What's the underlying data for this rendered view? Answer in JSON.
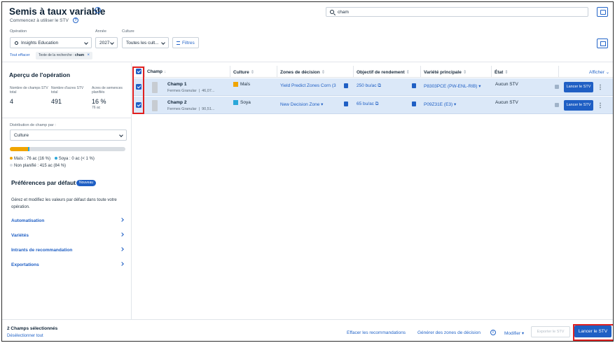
{
  "header": {
    "title": "Semis à taux variable",
    "subtitle": "Commencez à utiliser le STV",
    "search_value": "cham",
    "filters": {
      "operation_label": "Opération",
      "operation_value": "Insights Education",
      "year_label": "Année",
      "year_value": "2027",
      "crop_label": "Culture",
      "crop_value": "Toutes les cult...",
      "filters_button": "Filtres"
    },
    "clear_all": "Tout effacer",
    "chip_prefix": "Texte de la recherche :",
    "chip_value": "cham"
  },
  "overview": {
    "title": "Aperçu de l'opération",
    "stats": [
      {
        "label": "Nombre de champs STV total",
        "value": "4"
      },
      {
        "label": "Nombre d'acres STV total",
        "value": "491"
      },
      {
        "label": "Acres de semences planifiés",
        "value": "16 %",
        "sub": "76 ac"
      }
    ],
    "distribution_label": "Distribution de champ par :",
    "distribution_value": "Culture",
    "progress": {
      "mais_fraction": 0.16,
      "soya_fraction": 0.01
    },
    "legend": [
      {
        "text": "Maïs : 76 ac (16 %)",
        "color": "#f0a500"
      },
      {
        "text": "Soya : 0 ac (< 1 %)",
        "color": "#2ba7d9"
      },
      {
        "text": "Non planifié : 415 ac (84 %)",
        "color": "#d8dde2"
      }
    ]
  },
  "preferences": {
    "title": "Préférences par défaut",
    "badge": "Nouveau",
    "description": "Gérez et modifiez les valeurs par défaut dans toute votre opération.",
    "items": [
      "Automatisation",
      "Variétés",
      "Intrants de recommandation",
      "Exportations"
    ]
  },
  "table": {
    "columns": {
      "field": "Champ",
      "crop": "Culture",
      "zones": "Zones de décision",
      "yield": "Objectif de rendement",
      "variety": "Variété principale",
      "state": "État"
    },
    "show_label": "Afficher",
    "rows": [
      {
        "name": "Champ 1",
        "farm": "Fermes Granular",
        "area": "46,07...",
        "crop": "Maïs",
        "crop_color": "#f0a500",
        "zone": "Yield Predict Zones Corn (3",
        "yield": "250 bu/ac",
        "variety": "P8303PCE (PW-ENL-RIB)",
        "state": "Aucun STV",
        "launch": "Lancer le STV"
      },
      {
        "name": "Champ 2",
        "farm": "Fermes Granular",
        "area": "90,51...",
        "crop": "Soya",
        "crop_color": "#2ba7d9",
        "zone": "New Decision Zone",
        "yield": "65 bu/ac",
        "variety": "P09Z31E (E3)",
        "state": "Aucun STV",
        "launch": "Lancer le STV"
      }
    ]
  },
  "footer": {
    "selected": "2 Champs sélectionnés",
    "deselect": "Désélectionner tout",
    "clear_recs": "Effacer les recommandations",
    "gen_zones": "Générer des zones de décision",
    "modify": "Modifier",
    "export": "Exporter le STV",
    "launch": "Lancer le STV"
  }
}
